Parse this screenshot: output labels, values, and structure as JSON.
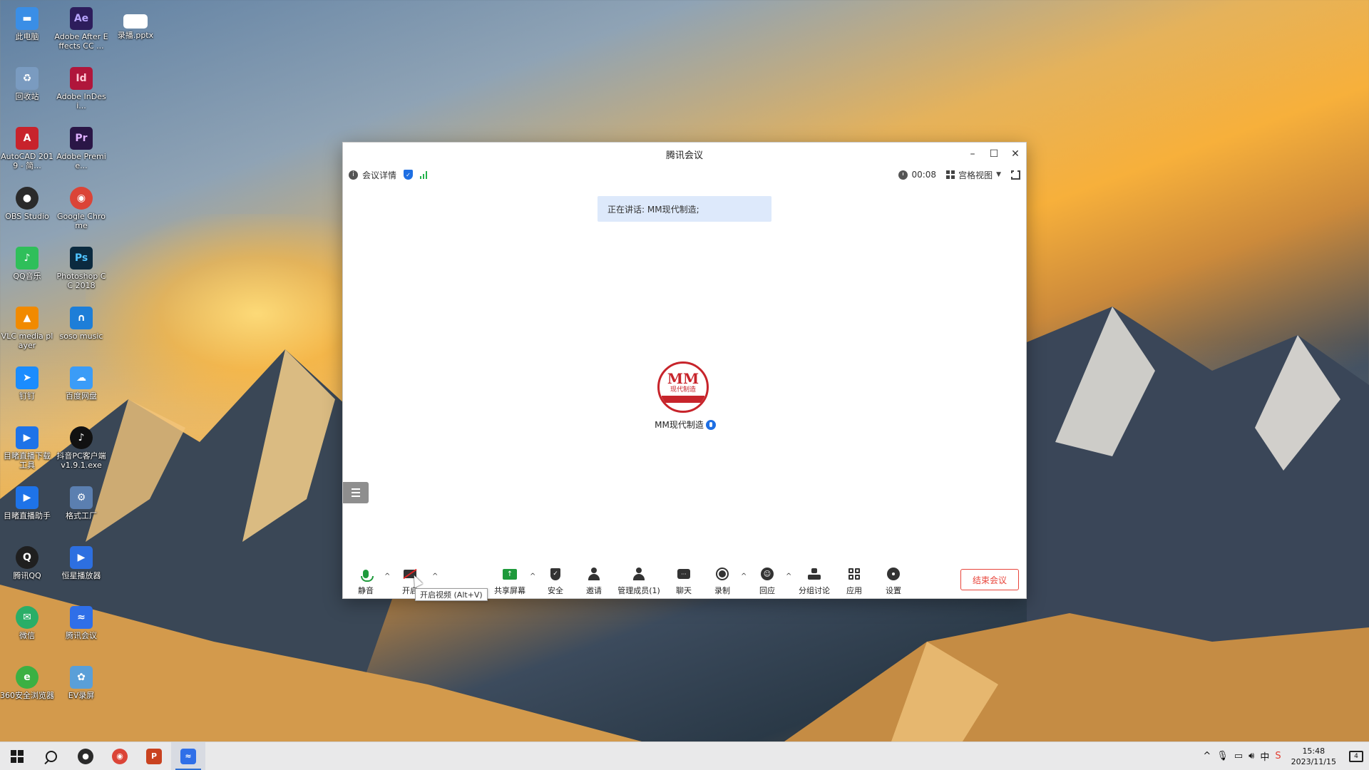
{
  "desktop": {
    "icons": [
      {
        "label": "此电脑",
        "color": "#3a8ee6",
        "glyph": "▬"
      },
      {
        "label": "Adobe After Effects CC ...",
        "color": "#2d1d5c",
        "glyph": "Ae"
      },
      {
        "label": "录播.pptx",
        "color": "#ffffff",
        "glyph": ""
      },
      {
        "label": "回收站",
        "color": "#7a9bc0",
        "glyph": "♻"
      },
      {
        "label": "Adobe InDesi...",
        "color": "#b0163b",
        "glyph": "Id"
      },
      {
        "label": "AutoCAD 2019 - 简...",
        "color": "#c8232c",
        "glyph": "A"
      },
      {
        "label": "Adobe Premie...",
        "color": "#2a1646",
        "glyph": "Pr"
      },
      {
        "label": "OBS Studio",
        "color": "#2a2a2a",
        "glyph": "●"
      },
      {
        "label": "Google Chrome",
        "color": "#db4437",
        "glyph": "◉"
      },
      {
        "label": "QQ音乐",
        "color": "#2fbf5a",
        "glyph": "♪"
      },
      {
        "label": "Photoshop CC 2018",
        "color": "#0b2a3f",
        "glyph": "Ps"
      },
      {
        "label": "VLC media player",
        "color": "#f18a00",
        "glyph": "▲"
      },
      {
        "label": "soso music",
        "color": "#1d7ed8",
        "glyph": "∩"
      },
      {
        "label": "钉钉",
        "color": "#1a8cff",
        "glyph": "➤"
      },
      {
        "label": "百度网盘",
        "color": "#3b9cf7",
        "glyph": "☁"
      },
      {
        "label": "目睹直播下载工具",
        "color": "#1e73e8",
        "glyph": "▶"
      },
      {
        "label": "抖音PC客户端 v1.9.1.exe",
        "color": "#111111",
        "glyph": "♪"
      },
      {
        "label": "目睹直播助手",
        "color": "#1e73e8",
        "glyph": "▶"
      },
      {
        "label": "格式工厂",
        "color": "#5b7fb0",
        "glyph": "⚙"
      },
      {
        "label": "腾讯QQ",
        "color": "#1f1f1f",
        "glyph": "Q"
      },
      {
        "label": "恒星播放器",
        "color": "#2d6fe0",
        "glyph": "▶"
      },
      {
        "label": "微信",
        "color": "#2aae67",
        "glyph": "✉"
      },
      {
        "label": "腾讯会议",
        "color": "#2f6fe8",
        "glyph": "≈"
      },
      {
        "label": "360安全浏览器",
        "color": "#3cb043",
        "glyph": "e"
      },
      {
        "label": "EV录屏",
        "color": "#5a9fd8",
        "glyph": "✿"
      }
    ]
  },
  "meeting": {
    "title": "腾讯会议",
    "detail_label": "会议详情",
    "timer": "00:08",
    "view_label": "宫格视图",
    "speaking_banner": "正在讲话: MM现代制造;",
    "participant": {
      "name": "MM现代制造",
      "avatar_text": "MM",
      "avatar_sub": "现代制造"
    },
    "toolbar": {
      "mute": "静音",
      "video": "开启",
      "share": "共享屏幕",
      "security": "安全",
      "invite": "邀请",
      "members": "管理成员(1)",
      "chat": "聊天",
      "record": "录制",
      "react": "回应",
      "breakout": "分组讨论",
      "apps": "应用",
      "settings": "设置",
      "end": "结束会议"
    },
    "tooltip": "开启视频 (Alt+V)"
  },
  "taskbar": {
    "time": "15:48",
    "date": "2023/11/15",
    "notification_count": "4"
  }
}
